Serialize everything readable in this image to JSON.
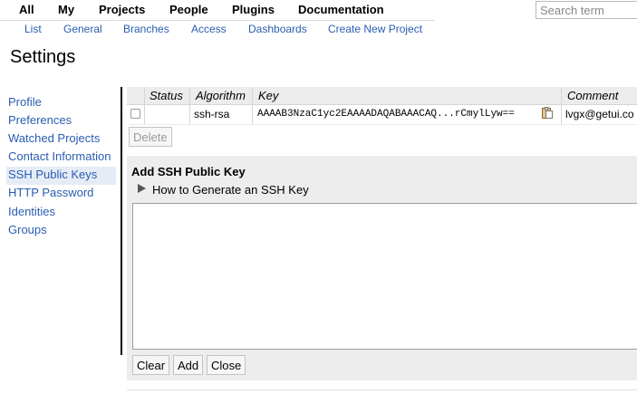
{
  "topnav": {
    "items": [
      {
        "label": "All"
      },
      {
        "label": "My"
      },
      {
        "label": "Projects"
      },
      {
        "label": "People"
      },
      {
        "label": "Plugins"
      },
      {
        "label": "Documentation"
      }
    ]
  },
  "subnav": {
    "items": [
      {
        "label": "List"
      },
      {
        "label": "General"
      },
      {
        "label": "Branches"
      },
      {
        "label": "Access"
      },
      {
        "label": "Dashboards"
      },
      {
        "label": "Create New Project"
      }
    ]
  },
  "search": {
    "placeholder": "Search term",
    "value": ""
  },
  "page": {
    "title": "Settings"
  },
  "sidebar": {
    "items": [
      {
        "label": "Profile"
      },
      {
        "label": "Preferences"
      },
      {
        "label": "Watched Projects"
      },
      {
        "label": "Contact Information"
      },
      {
        "label": "SSH Public Keys",
        "active": true
      },
      {
        "label": "HTTP Password"
      },
      {
        "label": "Identities"
      },
      {
        "label": "Groups"
      }
    ]
  },
  "keys_table": {
    "headers": {
      "status": "Status",
      "algorithm": "Algorithm",
      "key": "Key",
      "comment": "Comment"
    },
    "rows": [
      {
        "checked": false,
        "status": "",
        "algorithm": "ssh-rsa",
        "key": "AAAAB3NzaC1yc2EAAAADAQABAAACAQ...rCmylLyw==",
        "comment": "lvgx@getui.co"
      }
    ],
    "delete_label": "Delete"
  },
  "add_key": {
    "title": "Add SSH Public Key",
    "howto_label": "How to Generate an SSH Key",
    "textarea_value": "",
    "buttons": {
      "clear": "Clear",
      "add": "Add",
      "close": "Close"
    }
  },
  "colors": {
    "link": "#2a5db0",
    "active_bg": "#e6ecf6",
    "panel_bg": "#ededed",
    "header_bg": "#ececec"
  },
  "icons": {
    "copy": "clipboard-icon",
    "expand": "triangle-right-icon"
  }
}
